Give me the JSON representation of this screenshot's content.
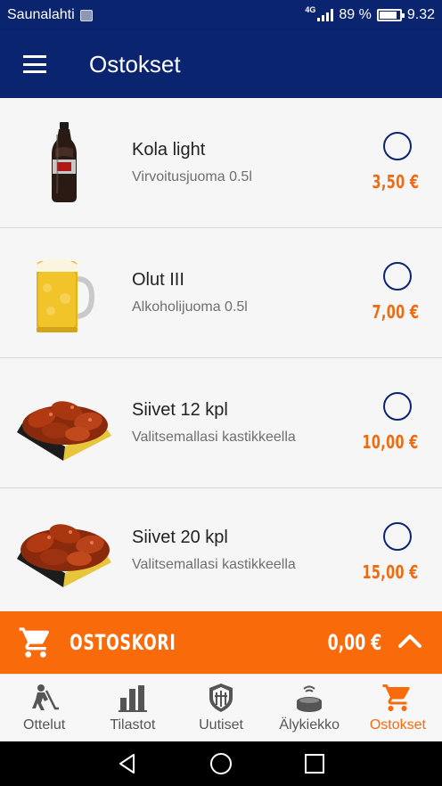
{
  "status_bar": {
    "carrier": "Saunalahti",
    "network": "4G",
    "battery_percent": "89 %",
    "battery_level": 0.89,
    "time": "9.32"
  },
  "app_bar": {
    "title": "Ostokset",
    "menu_icon": "hamburger-menu-icon"
  },
  "products": [
    {
      "name": "Kola light",
      "description": "Virvoitusjuoma 0.5l",
      "price": "3,50 €",
      "image": "cola-bottle",
      "selected": false
    },
    {
      "name": "Olut III",
      "description": "Alkoholijuoma 0.5l",
      "price": "7,00 €",
      "image": "beer-mug",
      "selected": false
    },
    {
      "name": "Siivet 12 kpl",
      "description": "Valitsemallasi kastikkeella",
      "price": "10,00 €",
      "image": "chicken-wings",
      "selected": false
    },
    {
      "name": "Siivet 20 kpl",
      "description": "Valitsemallasi kastikkeella",
      "price": "15,00 €",
      "image": "chicken-wings",
      "selected": false
    }
  ],
  "cart": {
    "label": "OSTOSKORI",
    "total": "0,00 €",
    "icon": "cart-icon",
    "expand_icon": "chevron-up-icon"
  },
  "bottom_nav": {
    "items": [
      {
        "label": "Ottelut",
        "icon": "hockey-player-icon",
        "active": false
      },
      {
        "label": "Tilastot",
        "icon": "bar-chart-icon",
        "active": false
      },
      {
        "label": "Uutiset",
        "icon": "shield-icon",
        "active": false
      },
      {
        "label": "Älykiekko",
        "icon": "puck-icon",
        "active": false
      },
      {
        "label": "Ostokset",
        "icon": "cart-icon",
        "active": true
      }
    ]
  },
  "colors": {
    "header": "#0a2470",
    "accent": "#f96a0b",
    "price": "#f06a10"
  }
}
